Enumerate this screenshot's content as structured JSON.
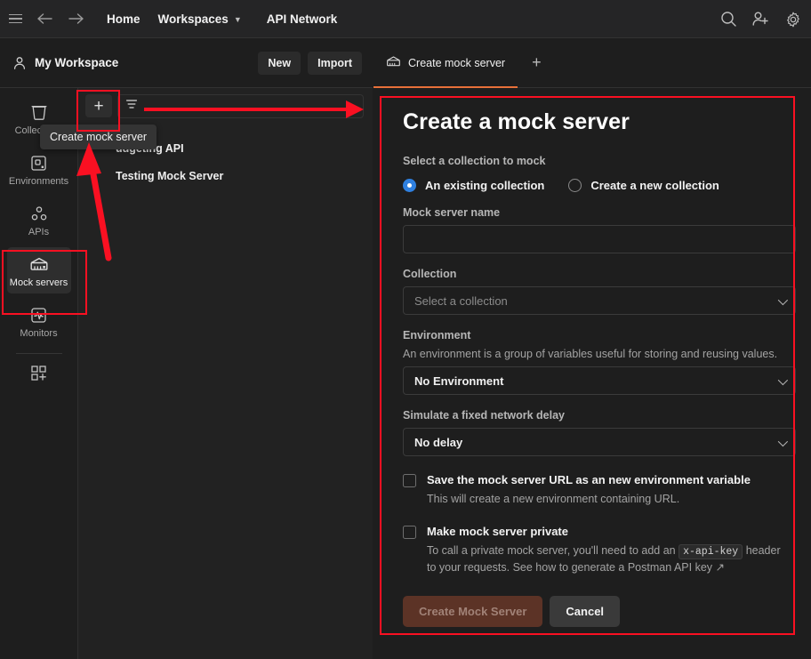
{
  "topbar": {
    "menu_icon": "hamburger-icon",
    "back_icon": "arrow-left-icon",
    "forward_icon": "arrow-right-icon",
    "home_label": "Home",
    "workspaces_label": "Workspaces",
    "api_network_label": "API Network",
    "search_icon": "search-icon",
    "invite_icon": "invite-user-icon",
    "settings_icon": "gear-icon"
  },
  "workspace": {
    "name": "My Workspace",
    "person_icon": "person-icon",
    "new_label": "New",
    "import_label": "Import"
  },
  "sidebar": {
    "items": [
      {
        "label": "Collections",
        "icon": "collections-icon",
        "active": false
      },
      {
        "label": "Environments",
        "icon": "environments-icon",
        "active": false
      },
      {
        "label": "APIs",
        "icon": "apis-icon",
        "active": false
      },
      {
        "label": "Mock servers",
        "icon": "mock-server-icon",
        "active": true
      },
      {
        "label": "Monitors",
        "icon": "monitor-icon",
        "active": false
      }
    ],
    "add_icon": "add-panel-icon"
  },
  "list_panel": {
    "create_icon": "plus-icon",
    "filter_icon": "filter-icon",
    "search_placeholder": "",
    "search_value": "",
    "items": [
      {
        "label": "udgeting API"
      },
      {
        "label": "Testing Mock Server"
      }
    ]
  },
  "tooltip": {
    "text": "Create mock server"
  },
  "tabs": {
    "items": [
      {
        "label": "Create mock server",
        "icon": "mock-server-icon",
        "active": true
      }
    ],
    "new_tab_icon": "plus-icon"
  },
  "form": {
    "title": "Create a mock server",
    "select_collection_label": "Select a collection to mock",
    "radio_existing": "An existing collection",
    "radio_new": "Create a new collection",
    "radio_selected": "existing",
    "mock_name_label": "Mock server name",
    "mock_name_value": "",
    "mock_name_placeholder": "",
    "collection_label": "Collection",
    "collection_placeholder": "Select a collection",
    "environment_label": "Environment",
    "environment_help": "An environment is a group of variables useful for storing and reusing values.",
    "environment_value": "No Environment",
    "delay_label": "Simulate a fixed network delay",
    "delay_value": "No delay",
    "save_url_title": "Save the mock server URL as an new environment variable",
    "save_url_desc": "This will create a new environment containing URL.",
    "save_url_checked": false,
    "private_title": "Make mock server private",
    "private_desc_part1": "To call a private mock server, you'll need to add an ",
    "private_code": "x-api-key",
    "private_desc_part2": " header to your requests. See how to generate a Postman API key ↗",
    "private_checked": false,
    "submit_label": "Create Mock Server",
    "cancel_label": "Cancel"
  },
  "colors": {
    "accent_orange": "#e8703a",
    "radio_blue": "#2f80e0",
    "annotation_red": "#fa1022",
    "app_bg": "#1e1e1e",
    "panel_bg": "#222222"
  }
}
